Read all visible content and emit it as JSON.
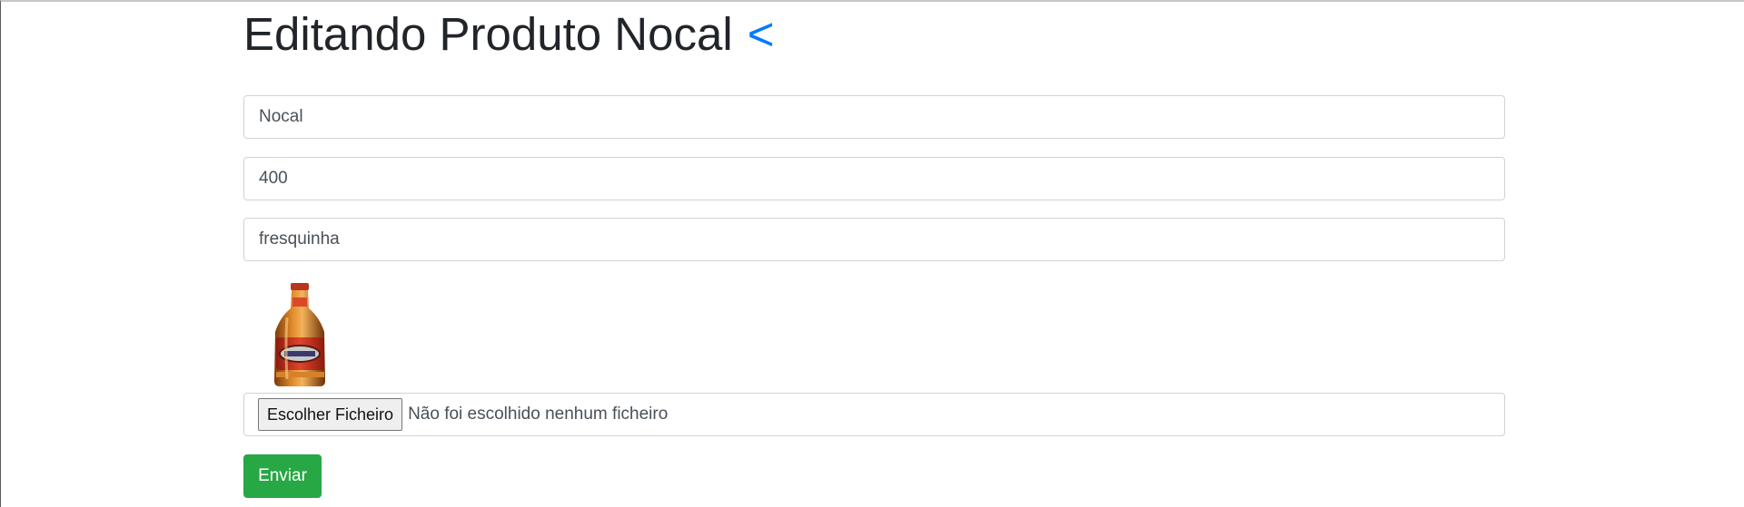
{
  "page": {
    "title": "Editando Produto Nocal",
    "back_link": "<"
  },
  "form": {
    "fields": [
      {
        "value": "Nocal"
      },
      {
        "value": "400"
      },
      {
        "value": "fresquinha"
      }
    ],
    "file_input": {
      "button_label": "Escolher Ficheiro",
      "status": "Não foi escolhido nenhum ficheiro"
    },
    "submit_label": "Enviar"
  },
  "colors": {
    "link": "#007bff",
    "submit_bg": "#28a745",
    "text": "#212529",
    "input_border": "#ced4da"
  }
}
